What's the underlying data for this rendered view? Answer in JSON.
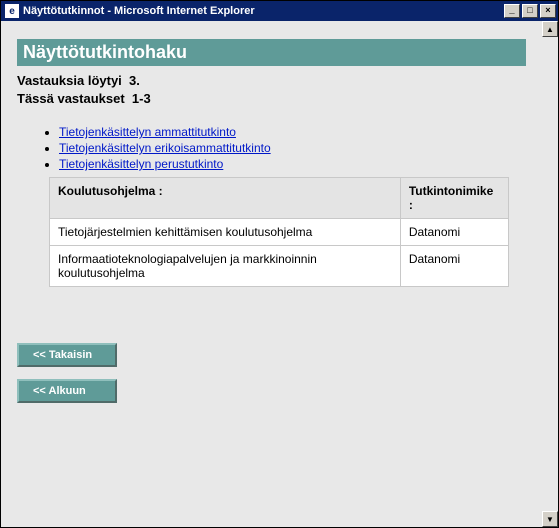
{
  "window": {
    "title": "Näyttötutkinnot - Microsoft Internet Explorer",
    "min": "_",
    "max": "□",
    "close": "×"
  },
  "page": {
    "heading": "Näyttötutkintohaku",
    "results_label": "Vastauksia löytyi",
    "results_count": "3.",
    "shown_label": "Tässä vastaukset",
    "shown_range": "1-3",
    "links": [
      "Tietojenkäsittelyn ammattitutkinto",
      "Tietojenkäsittelyn erikoisammattitutkinto",
      "Tietojenkäsittelyn perustutkinto"
    ],
    "table": {
      "col1": "Koulutusohjelma :",
      "col2": "Tutkintonimike :",
      "rows": [
        {
          "program": "Tietojärjestelmien kehittämisen koulutusohjelma",
          "qual": "Datanomi"
        },
        {
          "program": "Informaatioteknologiapalvelujen ja markkinoinnin koulutusohjelma",
          "qual": "Datanomi"
        }
      ]
    },
    "back_btn": "<<  Takaisin",
    "home_btn": "<<  Alkuun"
  }
}
